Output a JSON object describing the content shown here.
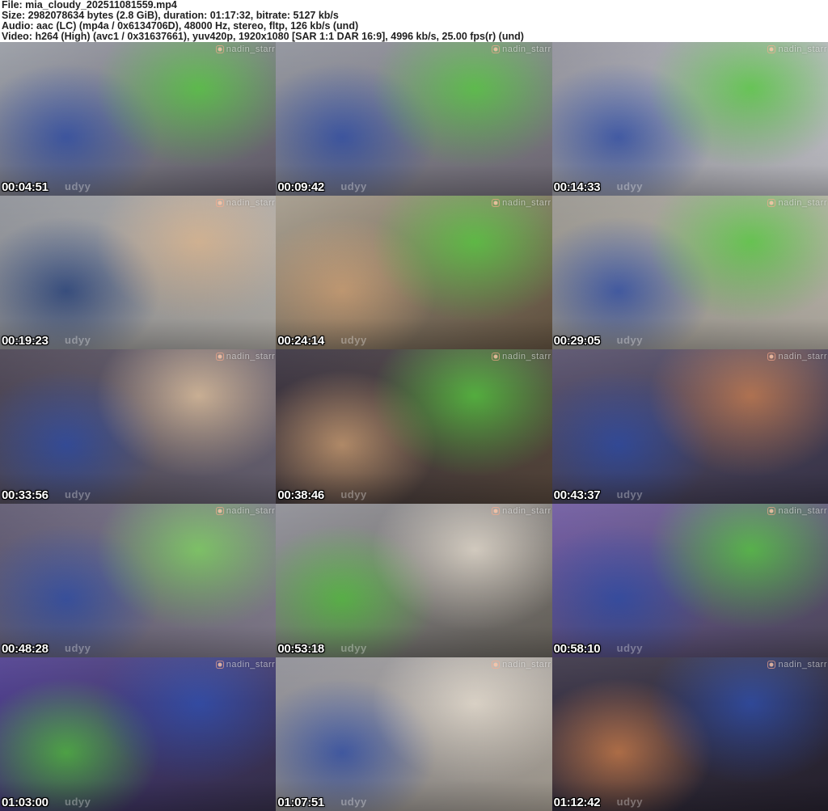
{
  "header": {
    "lines": [
      "File: mia_cloudy_202511081559.mp4",
      "Size: 2982078634 bytes (2.8 GiB), duration: 01:17:32, bitrate: 5127 kb/s",
      "Audio: aac (LC) (mp4a / 0x6134706D), 48000 Hz, stereo, fltp, 126 kb/s (und)",
      "Video: h264 (High) (avc1 / 0x31637661), yuv420p, 1920x1080 [SAR 1:1 DAR 16:9], 4996 kb/s, 25.00 fps(r) (und)"
    ]
  },
  "grid": {
    "columns": 3,
    "rows": 5,
    "watermark_top_right": "nadin_starr",
    "watermark_top_right_icon": "instagram-icon",
    "watermark_fragment": "udyy",
    "thumbnails": [
      {
        "timestamp": "00:04:51",
        "palette": [
          "#989ca4",
          "#6b6573",
          "#2f4fae",
          "#55c83e"
        ]
      },
      {
        "timestamp": "00:09:42",
        "palette": [
          "#8f929b",
          "#7a7480",
          "#2f4fae",
          "#55c83e"
        ]
      },
      {
        "timestamp": "00:14:33",
        "palette": [
          "#90909a",
          "#c9c9cf",
          "#2f4fae",
          "#55c83e"
        ]
      },
      {
        "timestamp": "00:19:23",
        "palette": [
          "#8d9097",
          "#b9b5ae",
          "#23407f",
          "#d9b38c"
        ]
      },
      {
        "timestamp": "00:24:14",
        "palette": [
          "#a39a8b",
          "#6b5a46",
          "#d9a87a",
          "#55c83e"
        ]
      },
      {
        "timestamp": "00:29:05",
        "palette": [
          "#97948e",
          "#bfb9ae",
          "#2f4fae",
          "#55c83e"
        ]
      },
      {
        "timestamp": "00:33:56",
        "palette": [
          "#4a4352",
          "#6e6878",
          "#2f4fae",
          "#e3c49e"
        ]
      },
      {
        "timestamp": "00:38:46",
        "palette": [
          "#3a3340",
          "#5a4a3e",
          "#d9a87a",
          "#55c83e"
        ]
      },
      {
        "timestamp": "00:43:37",
        "palette": [
          "#57506b",
          "#3f3a50",
          "#2f4fae",
          "#c87d4e"
        ]
      },
      {
        "timestamp": "00:48:28",
        "palette": [
          "#5e5870",
          "#8a8494",
          "#2f4fae",
          "#7ed45e"
        ]
      },
      {
        "timestamp": "00:53:18",
        "palette": [
          "#8e8e96",
          "#6f6a62",
          "#55c83e",
          "#e6ddcf"
        ]
      },
      {
        "timestamp": "00:58:10",
        "palette": [
          "#6f5aa0",
          "#575066",
          "#2f4fae",
          "#55c83e"
        ]
      },
      {
        "timestamp": "01:03:00",
        "palette": [
          "#4f3f8f",
          "#3a3350",
          "#55c83e",
          "#2f4fae"
        ]
      },
      {
        "timestamp": "01:07:51",
        "palette": [
          "#8e8e96",
          "#b0a89c",
          "#2f4fae",
          "#e6ddcf"
        ]
      },
      {
        "timestamp": "01:12:42",
        "palette": [
          "#3c3648",
          "#2a2533",
          "#d9854e",
          "#2f4fae"
        ]
      }
    ]
  },
  "colors": {
    "header_bg": "#ffffff",
    "header_text": "#1f1f1f",
    "timestamp_text": "#ffffff",
    "timestamp_outline": "#000000",
    "grid_bg": "#111111"
  }
}
